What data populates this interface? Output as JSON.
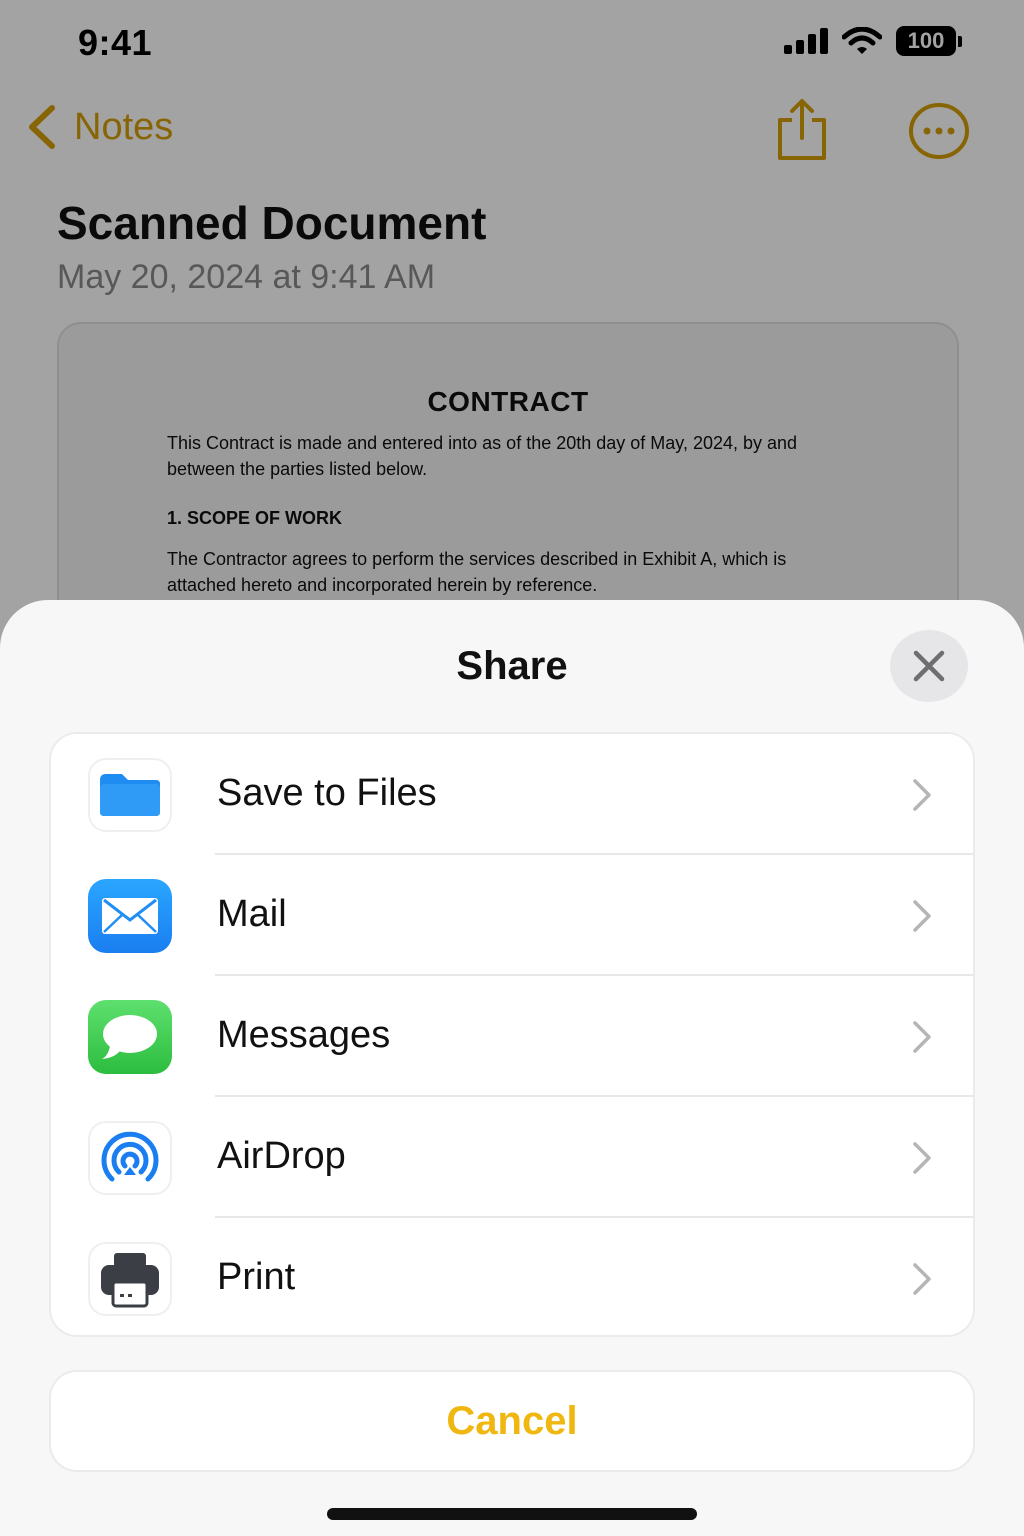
{
  "status_bar": {
    "time": "9:41",
    "battery": "100"
  },
  "nav": {
    "back_label": "Notes",
    "share_icon": "share-icon",
    "more_icon": "ellipsis-circle-icon",
    "accent_color": "#d49e08"
  },
  "note": {
    "title": "Scanned Document",
    "date": "May 20, 2024 at 9:41 AM",
    "document": {
      "heading": "CONTRACT",
      "paragraph1": "This Contract is made and entered into as of the 20th day of May, 2024, by and between the parties listed below.",
      "section1": "1.  SCOPE OF WORK",
      "paragraph2": "The Contractor agrees to perform the services described in Exhibit A, which is attached hereto and incorporated herein by reference."
    }
  },
  "share_sheet": {
    "title": "Share",
    "close_icon": "close-icon",
    "actions": [
      {
        "label": "Save to Files",
        "icon": "folder-icon"
      },
      {
        "label": "Mail",
        "icon": "mail-icon"
      },
      {
        "label": "Messages",
        "icon": "messages-icon"
      },
      {
        "label": "AirDrop",
        "icon": "airdrop-icon"
      },
      {
        "label": "Print",
        "icon": "printer-icon"
      }
    ],
    "cancel_label": "Cancel",
    "cancel_color": "#efb70f"
  }
}
